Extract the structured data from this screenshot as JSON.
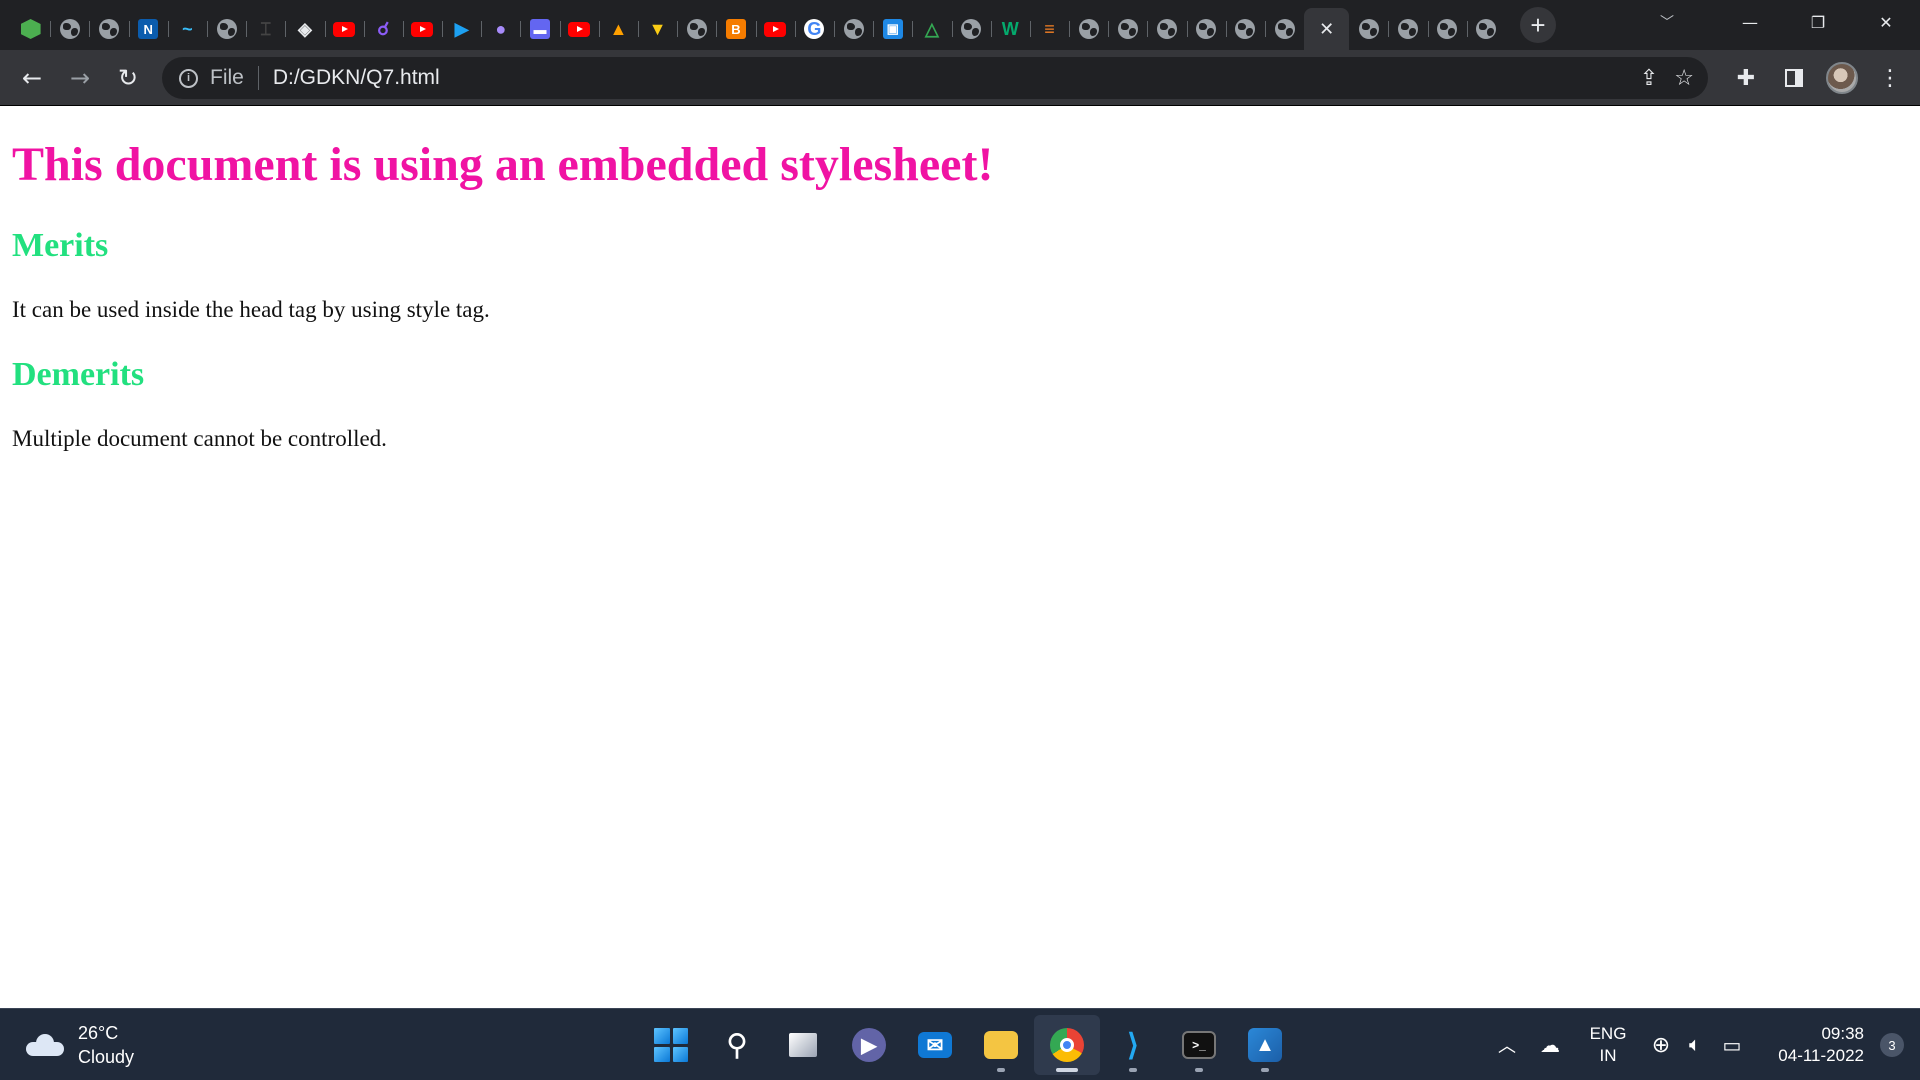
{
  "browser": {
    "tabs": [
      {
        "icon": "hexagon-icon",
        "color": "#4caf50"
      },
      {
        "icon": "globe-icon"
      },
      {
        "icon": "globe-icon"
      },
      {
        "icon": "notion-icon",
        "glyph": "N",
        "color": "#0b5cad"
      },
      {
        "icon": "tailwind-icon",
        "glyph": "~",
        "color": "#38bdf8"
      },
      {
        "icon": "globe-icon"
      },
      {
        "icon": "bracket-icon",
        "glyph": "⌶",
        "color": "#444"
      },
      {
        "icon": "codepen-icon",
        "glyph": "◈",
        "color": "#e8eaed"
      },
      {
        "icon": "youtube-icon"
      },
      {
        "icon": "link-icon",
        "glyph": "☌",
        "color": "#8b5cf6"
      },
      {
        "icon": "youtube-icon"
      },
      {
        "icon": "play-icon",
        "glyph": "▶",
        "color": "#1da1f2"
      },
      {
        "icon": "orb-icon",
        "glyph": "●",
        "color": "#a78bfa"
      },
      {
        "icon": "meet-icon",
        "glyph": "▬",
        "color": "#6366f1"
      },
      {
        "icon": "youtube-icon"
      },
      {
        "icon": "firebase-icon",
        "glyph": "▲",
        "color": "#ffa000"
      },
      {
        "icon": "cup-icon",
        "glyph": "▼",
        "color": "#facc15"
      },
      {
        "icon": "globe-icon"
      },
      {
        "icon": "blogger-icon",
        "glyph": "B",
        "color": "#f57c00"
      },
      {
        "icon": "youtube-icon"
      },
      {
        "icon": "google-icon",
        "glyph": "G",
        "color": "#4285f4"
      },
      {
        "icon": "globe-icon"
      },
      {
        "icon": "classroom-icon",
        "glyph": "▣",
        "color": "#1e88e5"
      },
      {
        "icon": "drive-icon",
        "glyph": "△",
        "color": "#34a853"
      },
      {
        "icon": "globe-icon"
      },
      {
        "icon": "w3-icon",
        "glyph": "W",
        "color": "#04aa6d"
      },
      {
        "icon": "stackoverflow-icon",
        "glyph": "≡",
        "color": "#f48024"
      },
      {
        "icon": "globe-icon"
      },
      {
        "icon": "globe-icon"
      },
      {
        "icon": "globe-icon"
      },
      {
        "icon": "globe-icon"
      },
      {
        "icon": "globe-icon"
      },
      {
        "icon": "globe-icon"
      },
      {
        "icon": "close-icon",
        "active": true
      },
      {
        "icon": "globe-icon"
      },
      {
        "icon": "globe-icon"
      },
      {
        "icon": "globe-icon"
      },
      {
        "icon": "globe-icon"
      }
    ],
    "address": {
      "scheme": "File",
      "url": "D:/GDKN/Q7.html"
    }
  },
  "page": {
    "heading": "This document is using an embedded stylesheet!",
    "sections": [
      {
        "title": "Merits",
        "text": "It can be used inside the head tag by using style tag."
      },
      {
        "title": "Demerits",
        "text": "Multiple document cannot be controlled."
      }
    ],
    "colors": {
      "heading": "#f013a3",
      "subheading": "#22e07f"
    }
  },
  "taskbar": {
    "weather": {
      "temp": "26°C",
      "condition": "Cloudy"
    },
    "language": {
      "lang": "ENG",
      "region": "IN"
    },
    "clock": {
      "time": "09:38",
      "date": "04-11-2022"
    },
    "notifications": "3"
  }
}
